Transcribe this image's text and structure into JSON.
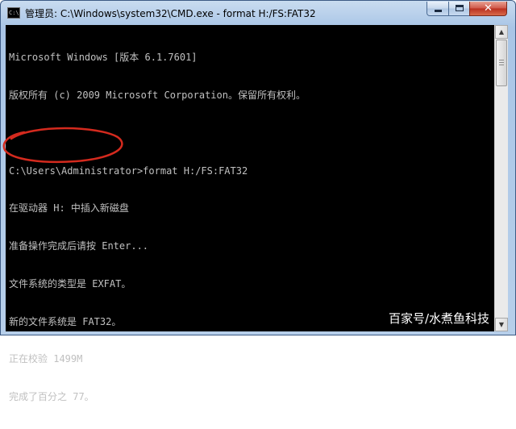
{
  "window": {
    "title": "管理员: C:\\Windows\\system32\\CMD.exe - format  H:/FS:FAT32",
    "app_icon": "cmd-icon",
    "app_icon_text": "C:\\",
    "buttons": {
      "minimize": "minimize-icon",
      "maximize": "maximize-icon",
      "close": "close-icon"
    }
  },
  "console": {
    "lines": [
      "Microsoft Windows [版本 6.1.7601]",
      "版权所有 (c) 2009 Microsoft Corporation。保留所有权利。",
      "",
      "C:\\Users\\Administrator>format H:/FS:FAT32",
      "在驱动器 H: 中插入新磁盘",
      "准备操作完成后请按 Enter...",
      "文件系统的类型是 EXFAT。",
      "新的文件系统是 FAT32。",
      "正在校验 1499M",
      "完成了百分之 77。"
    ],
    "text_color": "#c0c0c0",
    "background": "#000000"
  },
  "annotation": {
    "shape": "ellipse",
    "color": "#d42a1e"
  },
  "watermark": {
    "text": "百家号/水煮鱼科技"
  }
}
